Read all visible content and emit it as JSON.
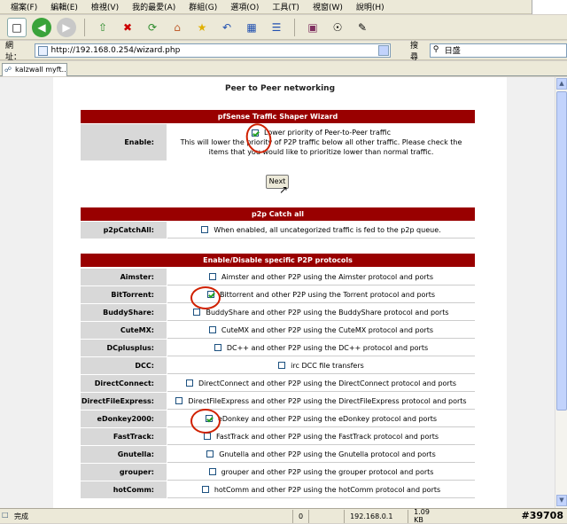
{
  "menu": [
    "檔案(F)",
    "編輯(E)",
    "檢視(V)",
    "我的最愛(A)",
    "群組(G)",
    "選項(O)",
    "工具(T)",
    "視窗(W)",
    "說明(H)"
  ],
  "address": {
    "label": "網址：",
    "url": "http://192.168.0.254/wizard.php"
  },
  "search": {
    "label": "搜尋",
    "value": "日盛"
  },
  "tab": {
    "label": "kalzwall myft..."
  },
  "page": {
    "title": "Peer to Peer networking",
    "wizard_header": "pfSense Traffic Shaper Wizard",
    "enable": {
      "label": "Enable:",
      "checkbox_label": "Lower priority of Peer-to-Peer traffic",
      "description": "This will lower the priority of P2P traffic below all other traffic. Please check the items that you would like to prioritize lower than normal traffic.",
      "checked": true
    },
    "next_label": "Next",
    "catchall_header": "p2p Catch all",
    "catchall": {
      "label": "p2pCatchAll:",
      "text": "When enabled, all uncategorized traffic is fed to the p2p queue.",
      "checked": false
    },
    "protocols_header": "Enable/Disable specific P2P protocols",
    "protocols": [
      {
        "label": "Aimster:",
        "text": "Aimster and other P2P using the Aimster protocol and ports",
        "checked": false
      },
      {
        "label": "BitTorrent:",
        "text": "Bittorrent and other P2P using the Torrent protocol and ports",
        "checked": true
      },
      {
        "label": "BuddyShare:",
        "text": "BuddyShare and other P2P using the BuddyShare protocol and ports",
        "checked": false
      },
      {
        "label": "CuteMX:",
        "text": "CuteMX and other P2P using the CuteMX protocol and ports",
        "checked": false
      },
      {
        "label": "DCplusplus:",
        "text": "DC++ and other P2P using the DC++ protocol and ports",
        "checked": false
      },
      {
        "label": "DCC:",
        "text": "irc DCC file transfers",
        "checked": false
      },
      {
        "label": "DirectConnect:",
        "text": "DirectConnect and other P2P using the DirectConnect protocol and ports",
        "checked": false
      },
      {
        "label": "DirectFileExpress:",
        "text": "DirectFileExpress and other P2P using the DirectFileExpress protocol and ports",
        "checked": false
      },
      {
        "label": "eDonkey2000:",
        "text": "eDonkey and other P2P using the eDonkey protocol and ports",
        "checked": true
      },
      {
        "label": "FastTrack:",
        "text": "FastTrack and other P2P using the FastTrack protocol and ports",
        "checked": false
      },
      {
        "label": "Gnutella:",
        "text": "Gnutella and other P2P using the Gnutella protocol and ports",
        "checked": false
      },
      {
        "label": "grouper:",
        "text": "grouper and other P2P using the grouper protocol and ports",
        "checked": false
      },
      {
        "label": "hotComm:",
        "text": "hotComm and other P2P using the hotComm protocol and ports",
        "checked": false
      }
    ]
  },
  "status": {
    "left": "完成",
    "count": "0",
    "ip": "192.168.0.1",
    "size": "1.09 KB",
    "watermark": "#39708"
  }
}
